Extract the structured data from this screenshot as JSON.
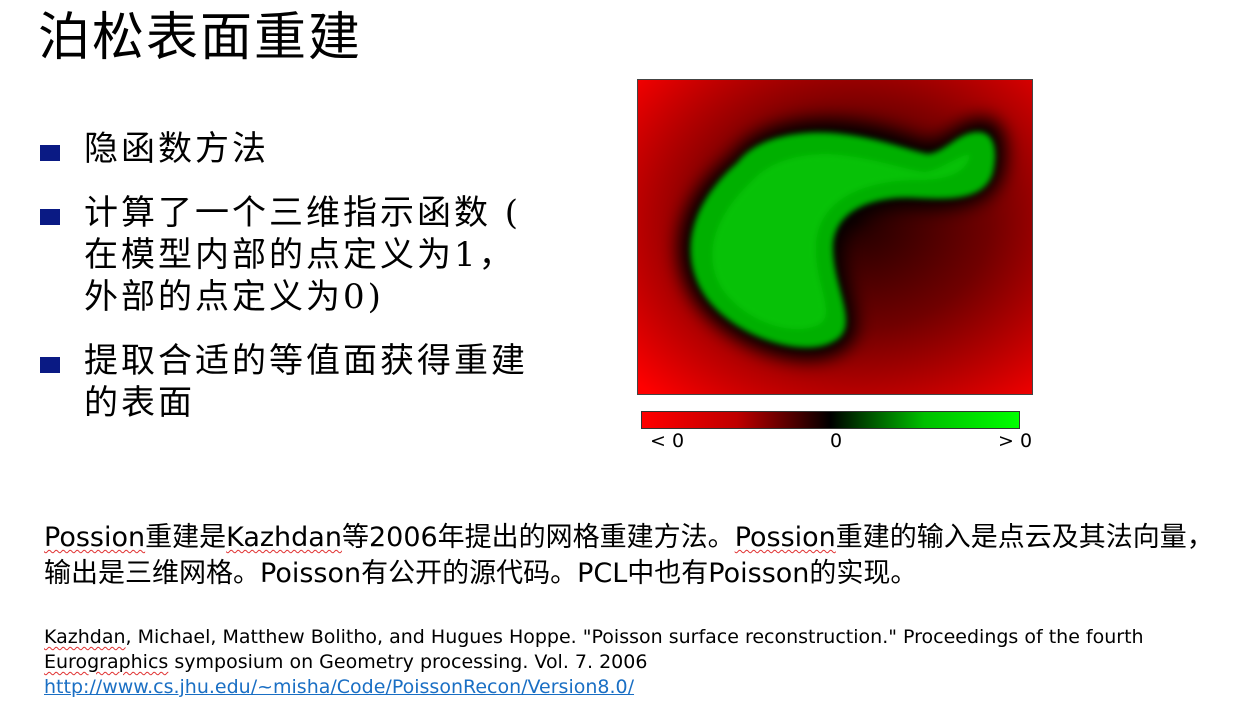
{
  "title": "泊松表面重建",
  "bullets": [
    "隐函数方法",
    "计算了一个三维指示函数 ( 在模型内部的点定义为1， 外部的点定义为0)",
    "提取合适的等值面获得重建的表面"
  ],
  "colorbar": {
    "left_label": "< 0",
    "mid_label": "0",
    "right_label": "> 0",
    "colors": [
      "#ff0000",
      "#000000",
      "#00ff00"
    ]
  },
  "paragraph": {
    "w1": "Possion",
    "t1": "重建是",
    "w2": "Kazhdan",
    "t2": "等2006年提出的网格重建方法。",
    "w3": "Possion",
    "t3": "重建的输入是点云及其法向量，输出是三维网格。Poisson有公开的源代码。PCL中也有Poisson的实现。"
  },
  "reference": {
    "author": "Kazhdan",
    "text1": ", Michael, Matthew Bolitho, and Hugues Hoppe. \"Poisson surface reconstruction.\" Proceedings of the fourth ",
    "venue": "Eurographics",
    "text2": " symposium on Geometry processing. Vol. 7. 2006",
    "link": "http://www.cs.jhu.edu/~misha/Code/PoissonRecon/Version8.0/"
  }
}
